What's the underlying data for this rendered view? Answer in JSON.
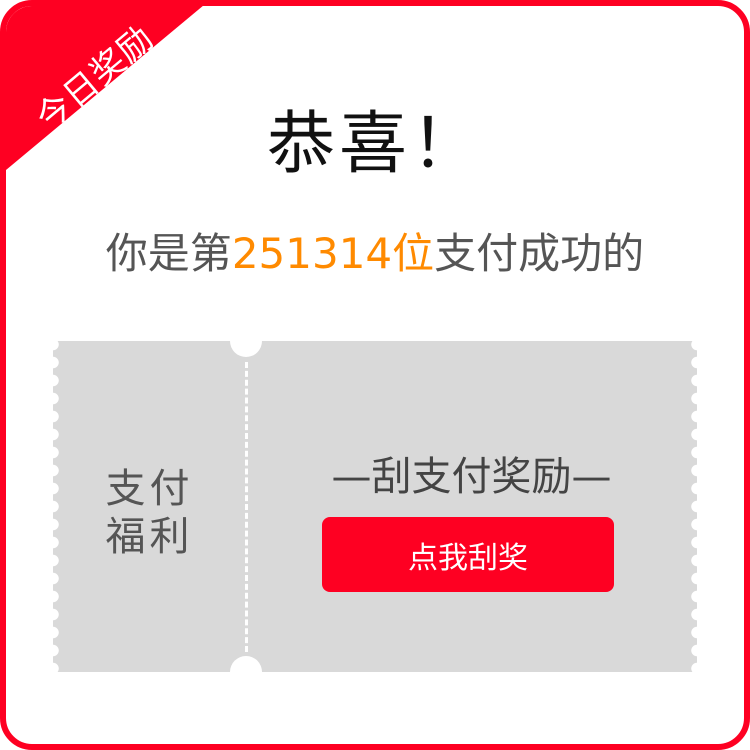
{
  "ribbon": {
    "label": "今日奖励"
  },
  "title": "恭喜！",
  "subtitle": {
    "prefix": "你是第",
    "number": "251314",
    "unit": "位",
    "suffix": "支付成功的"
  },
  "ticket": {
    "left_line1": "支付",
    "left_line2": "福利",
    "prize_title": "—刮支付奖励—",
    "button": "点我刮奖"
  },
  "colors": {
    "accent": "#fe0022",
    "highlight": "#ff8a00",
    "ticket": "#d9d9d9"
  }
}
